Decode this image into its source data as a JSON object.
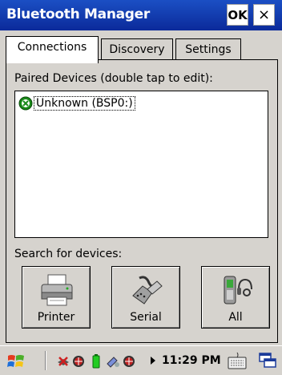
{
  "window": {
    "title": "Bluetooth Manager",
    "ok_label": "OK",
    "close_label": "×"
  },
  "tabs": [
    {
      "label": "Connections",
      "active": true
    },
    {
      "label": "Discovery",
      "active": false
    },
    {
      "label": "Settings",
      "active": false
    }
  ],
  "connections": {
    "paired_label": "Paired Devices (double tap to edit):",
    "devices": [
      {
        "label": "Unknown (BSP0:)",
        "icon": "bluetooth-device-icon"
      }
    ],
    "search_label": "Search for devices:",
    "buttons": [
      {
        "label": "Printer",
        "icon": "printer-icon"
      },
      {
        "label": "Serial",
        "icon": "serial-cable-icon"
      },
      {
        "label": "All",
        "icon": "phone-headset-icon"
      }
    ]
  },
  "taskbar": {
    "clock": "11:29 PM",
    "icons": [
      "windows-start-icon",
      "no-signal-icon",
      "network-globe-icon",
      "battery-icon",
      "sync-icon",
      "network-globe-icon",
      "keyboard-icon",
      "windows-icon"
    ]
  },
  "colors": {
    "titlebar": "#0b2a9a",
    "background": "#d6d3ce",
    "battery": "#22cc22"
  }
}
